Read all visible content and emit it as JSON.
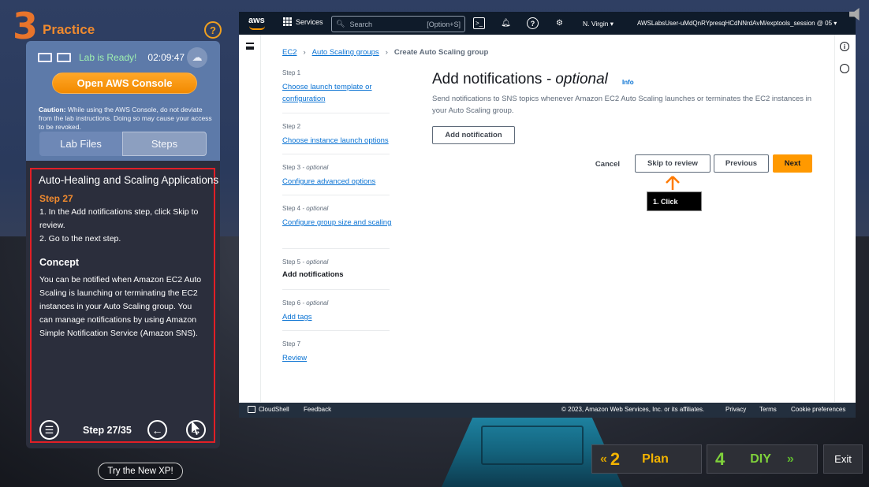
{
  "practice": {
    "number": "3",
    "label": "Practice",
    "help": "?"
  },
  "lab": {
    "status": "Lab is Ready!",
    "timer": "02:09:47",
    "open_console": "Open AWS Console",
    "caution_label": "Caution:",
    "caution_text": "While using the AWS Console, do not deviate from the lab instructions. Doing so may cause your access to be revoked.",
    "tabs": [
      "Lab Files",
      "Steps"
    ]
  },
  "steps": {
    "title": "Auto-Healing and Scaling Applications",
    "step_number": "Step 27",
    "line1": "1. In the Add notifications step, click Skip to review.",
    "line2": "2. Go to the next step.",
    "concept_title": "Concept",
    "concept_text": "You can be notified when Amazon EC2 Auto Scaling is launching or terminating the EC2 instances in your Auto Scaling group. You can manage notifications by using Amazon Simple Notification Service (Amazon SNS).",
    "counter": "Step 27/35"
  },
  "try_xp": "Try the New XP!",
  "aws": {
    "logo": "aws",
    "services": "Services",
    "search_placeholder": "Search",
    "search_shortcut": "[Option+S]",
    "region": "N. Virgin ▾",
    "account": "AWSLabsUser-uMdQnRYpresqHCdNNrdAvM/exptools_session @ 05 ▾",
    "breadcrumb": [
      "EC2",
      "Auto Scaling groups",
      "Create Auto Scaling group"
    ],
    "wizard": [
      {
        "label": "Step 1",
        "optional": "",
        "title": "Choose launch template or configuration",
        "current": false
      },
      {
        "label": "Step 2",
        "optional": "",
        "title": "Choose instance launch options",
        "current": false
      },
      {
        "label": "Step 3",
        "optional": " - optional",
        "title": "Configure advanced options",
        "current": false
      },
      {
        "label": "Step 4",
        "optional": " - optional",
        "title": "Configure group size and scaling",
        "current": false
      },
      {
        "label": "Step 5",
        "optional": " - optional",
        "title": "Add notifications",
        "current": true
      },
      {
        "label": "Step 6",
        "optional": " - optional",
        "title": "Add tags",
        "current": false
      },
      {
        "label": "Step 7",
        "optional": "",
        "title": "Review",
        "current": false
      }
    ],
    "heading": "Add notifications",
    "heading_optional": " - optional",
    "info": "Info",
    "description": "Send notifications to SNS topics whenever Amazon EC2 Auto Scaling launches or terminates the EC2 instances in your Auto Scaling group.",
    "add_notification": "Add notification",
    "cancel": "Cancel",
    "skip_to_review": "Skip to review",
    "previous": "Previous",
    "next": "Next",
    "click_tip": "1. Click",
    "footer": {
      "cloudshell": "CloudShell",
      "feedback": "Feedback",
      "copyright": "© 2023, Amazon Web Services, Inc. or its affiliates.",
      "privacy": "Privacy",
      "terms": "Terms",
      "cookies": "Cookie preferences"
    }
  },
  "nav": {
    "plan_num": "2",
    "plan_label": "Plan",
    "plan_chevron": "«",
    "diy_num": "4",
    "diy_label": "DIY",
    "diy_chevron": "»",
    "exit": "Exit"
  },
  "colors": {
    "accent_orange": "#ff9900",
    "practice_orange": "#f08a2e",
    "plan_yellow": "#f2b300",
    "diy_green": "#7fd13b",
    "highlight_red": "#e21f26"
  }
}
